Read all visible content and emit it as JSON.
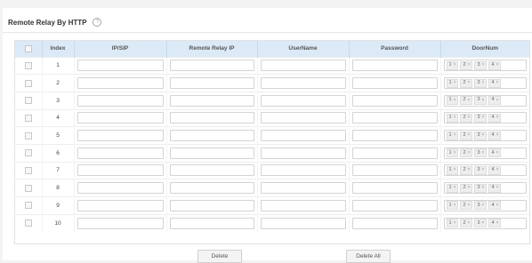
{
  "section": {
    "title": "Remote Relay By HTTP",
    "help_icon": "?"
  },
  "table": {
    "columns": [
      "",
      "Index",
      "IP/SIP",
      "Remote Relay IP",
      "UserName",
      "Password",
      "DoorNum"
    ],
    "rows": [
      {
        "index": "1",
        "ip_sip": "",
        "remote_relay_ip": "",
        "username": "",
        "password": ""
      },
      {
        "index": "2",
        "ip_sip": "",
        "remote_relay_ip": "",
        "username": "",
        "password": ""
      },
      {
        "index": "3",
        "ip_sip": "",
        "remote_relay_ip": "",
        "username": "",
        "password": ""
      },
      {
        "index": "4",
        "ip_sip": "",
        "remote_relay_ip": "",
        "username": "",
        "password": ""
      },
      {
        "index": "5",
        "ip_sip": "",
        "remote_relay_ip": "",
        "username": "",
        "password": ""
      },
      {
        "index": "6",
        "ip_sip": "",
        "remote_relay_ip": "",
        "username": "",
        "password": ""
      },
      {
        "index": "7",
        "ip_sip": "",
        "remote_relay_ip": "",
        "username": "",
        "password": ""
      },
      {
        "index": "8",
        "ip_sip": "",
        "remote_relay_ip": "",
        "username": "",
        "password": ""
      },
      {
        "index": "9",
        "ip_sip": "",
        "remote_relay_ip": "",
        "username": "",
        "password": ""
      },
      {
        "index": "10",
        "ip_sip": "",
        "remote_relay_ip": "",
        "username": "",
        "password": ""
      }
    ],
    "door_tags": [
      "1",
      "2",
      "3",
      "4"
    ],
    "tag_remove_glyph": "×"
  },
  "actions": {
    "delete_label": "Delete",
    "delete_all_label": "Delete All"
  },
  "colors": {
    "header_bg": "#dce9f7",
    "page_bg": "#f3f3f3"
  }
}
